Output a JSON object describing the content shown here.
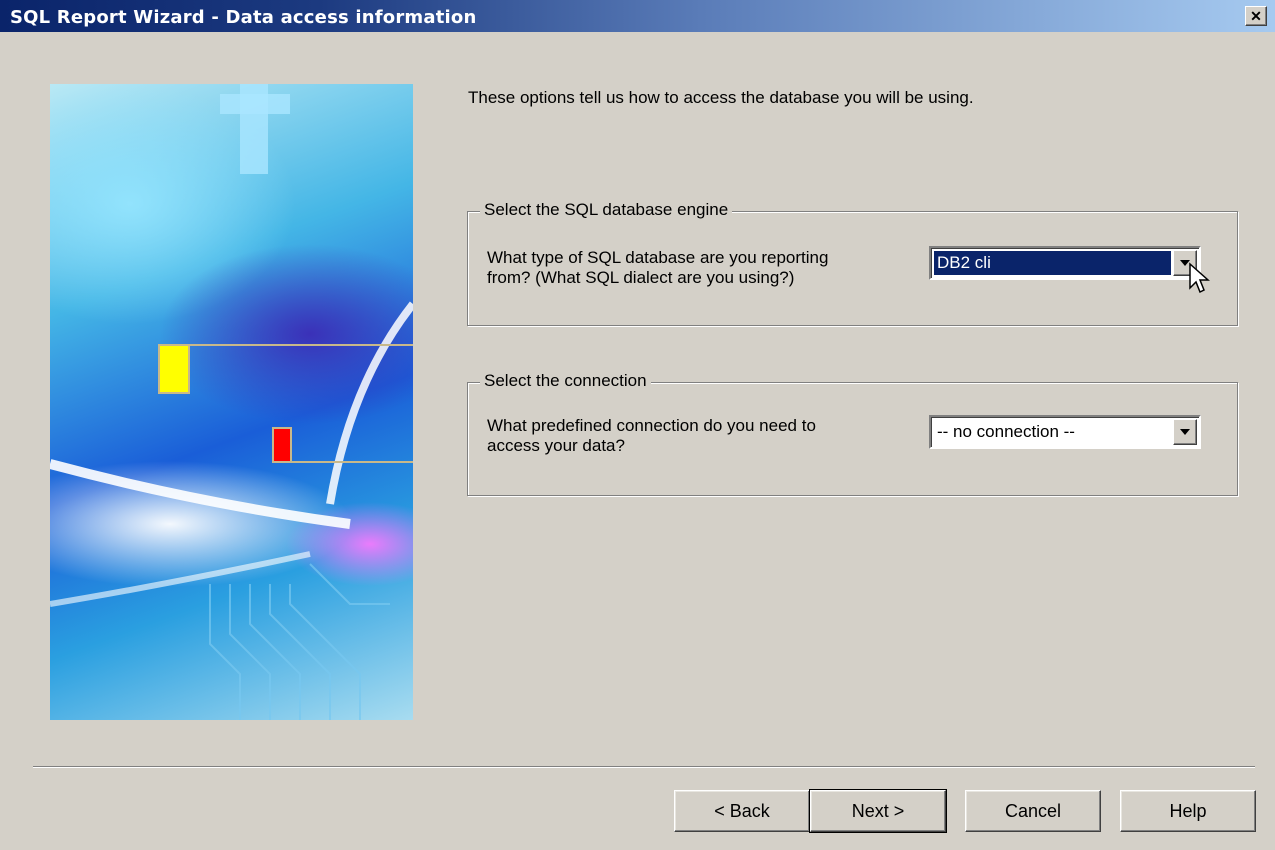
{
  "window": {
    "title": "SQL Report Wizard - Data access information",
    "close_glyph": "✕"
  },
  "intro_text": "These options tell us how to access the database you will be using.",
  "engine_group": {
    "legend": "Select the SQL database engine",
    "question_line1": "What type of SQL database are you reporting",
    "question_line2": "from? (What SQL dialect are you using?)",
    "selected_value": "DB2 cli"
  },
  "connection_group": {
    "legend": "Select the connection",
    "question_line1": "What predefined connection do you need to",
    "question_line2": "access your data?",
    "selected_value": "-- no connection --"
  },
  "buttons": {
    "back": "< Back",
    "next": "Next >",
    "cancel": "Cancel",
    "help": "Help"
  },
  "colors": {
    "title_bar_start": "#0a246a",
    "title_bar_end": "#a6caf0",
    "selection": "#0a246a",
    "dialog_bg": "#d4d0c8"
  }
}
